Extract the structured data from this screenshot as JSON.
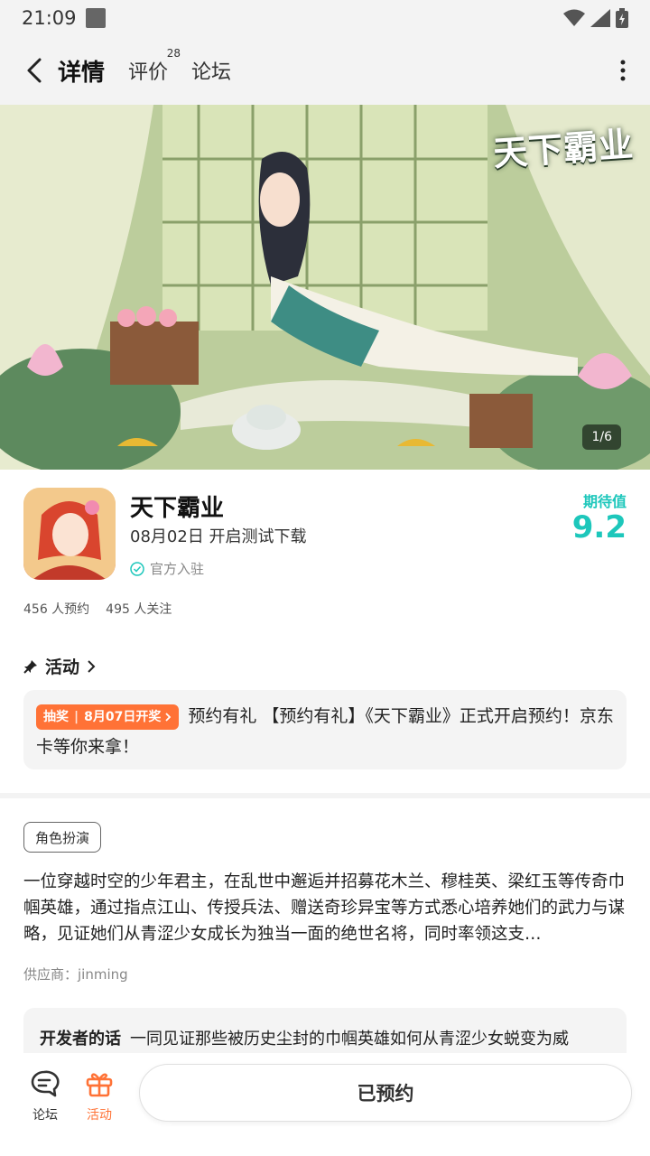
{
  "status": {
    "time": "21:09"
  },
  "nav": {
    "tabs": [
      {
        "label": "详情",
        "active": true
      },
      {
        "label": "评价",
        "badge": "28"
      },
      {
        "label": "论坛"
      }
    ]
  },
  "banner": {
    "logo_text": "天下霸业",
    "counter": "1/6"
  },
  "game": {
    "title": "天下霸业",
    "release": "08月02日 开启测试下载",
    "official": "官方入驻",
    "expect_label": "期待值",
    "expect_score": "9.2",
    "reservations": "456 人预约",
    "followers": "495 人关注"
  },
  "activity": {
    "header": "活动",
    "tag_left": "抽奖",
    "tag_right": "8月07日开奖",
    "text": "预约有礼 【预约有礼】《天下霸业》正式开启预约！京东卡等你来拿！"
  },
  "details": {
    "genre": "角色扮演",
    "description": "一位穿越时空的少年君主，在乱世中邂逅并招募花木兰、穆桂英、梁红玉等传奇巾帼英雄，通过指点江山、传授兵法、赠送奇珍异宝等方式悉心培养她们的武力与谋略，见证她们从青涩少女成长为独当一面的绝世名将，同时率领这支…",
    "supplier": "供应商：jinming"
  },
  "developer": {
    "label": "开发者的话",
    "text": "一同见证那些被历史尘封的巾帼英雄如何从青涩少女蜕变为威"
  },
  "bottom": {
    "forum_label": "论坛",
    "activity_label": "活动",
    "reserve_label": "已预约"
  },
  "colors": {
    "accent": "#1dc7bb",
    "orange": "#ff7236"
  }
}
